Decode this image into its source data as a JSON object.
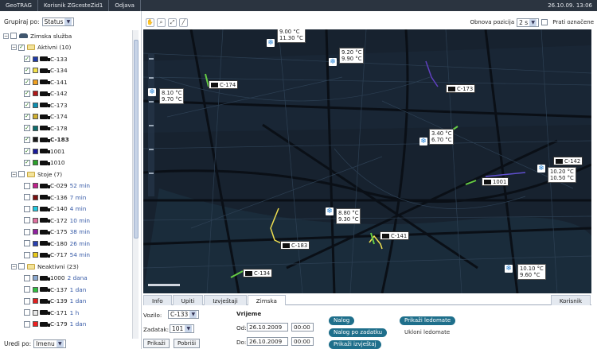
{
  "topbar": {
    "app": "GeoTRAG",
    "user": "Korisnik ZGcesteZid1",
    "logout": "Odjava",
    "datetime": "26.10.09. 13:06"
  },
  "left": {
    "group_label": "Grupiraj po:",
    "group_value": "Status",
    "sort_label": "Uredi po:",
    "sort_value": "Imenu",
    "tree": {
      "root": "Zimska služba",
      "groups": [
        {
          "label": "Aktivni (10)",
          "items": [
            {
              "name": "C-133",
              "color": "#1e3aa8",
              "dur": ""
            },
            {
              "name": "C-134",
              "color": "#f3e14a",
              "dur": ""
            },
            {
              "name": "C-141",
              "color": "#f0a020",
              "dur": ""
            },
            {
              "name": "C-142",
              "color": "#b01818",
              "dur": ""
            },
            {
              "name": "C-173",
              "color": "#0e8fb0",
              "dur": ""
            },
            {
              "name": "C-174",
              "color": "#d0b030",
              "dur": ""
            },
            {
              "name": "C-178",
              "color": "#0c6c6c",
              "dur": ""
            },
            {
              "name": "C-183",
              "color": "#1a1a1a",
              "dur": ""
            },
            {
              "name": "1001",
              "color": "#1a1a9a",
              "dur": ""
            },
            {
              "name": "1010",
              "color": "#2aa02a",
              "dur": ""
            }
          ]
        },
        {
          "label": "Stoje (7)",
          "items": [
            {
              "name": "C-029",
              "color": "#c0208c",
              "dur": "52 min"
            },
            {
              "name": "C-136",
              "color": "#7a1010",
              "dur": "7 min"
            },
            {
              "name": "C-140",
              "color": "#20c8e0",
              "dur": "4 min"
            },
            {
              "name": "C-172",
              "color": "#e070a0",
              "dur": "10 min"
            },
            {
              "name": "C-175",
              "color": "#9020a0",
              "dur": "38 min"
            },
            {
              "name": "C-180",
              "color": "#2a40b0",
              "dur": "26 min"
            },
            {
              "name": "C-717",
              "color": "#e8c818",
              "dur": "54 min"
            }
          ]
        },
        {
          "label": "Neaktivni (23)",
          "items": [
            {
              "name": "1000",
              "color": "#8aa8d0",
              "dur": "2 dana"
            },
            {
              "name": "C-137",
              "color": "#30c040",
              "dur": "1 dan"
            },
            {
              "name": "C-139",
              "color": "#e02020",
              "dur": "1 dan"
            },
            {
              "name": "C-171",
              "color": "#e8e8e8",
              "dur": "1 h"
            },
            {
              "name": "C-179",
              "color": "#ee2020",
              "dur": "1 dan"
            }
          ]
        }
      ]
    }
  },
  "map_toolbar": {
    "refresh_label": "Obnova pozicija",
    "refresh_value": "2 s",
    "follow_label": "Prati označene"
  },
  "map": {
    "vehicles": [
      {
        "name": "C-174"
      },
      {
        "name": "C-173"
      },
      {
        "name": "C-142"
      },
      {
        "name": "1001"
      },
      {
        "name": "C-141"
      },
      {
        "name": "C-183"
      },
      {
        "name": "C-134"
      }
    ],
    "temps": [
      {
        "a": "9.00 °C",
        "b": "11.30 °C"
      },
      {
        "a": "9.20 °C",
        "b": "9.90 °C"
      },
      {
        "a": "8.10 °C",
        "b": "9.70 °C"
      },
      {
        "a": "3.40 °C",
        "b": "6.70 °C"
      },
      {
        "a": "10.20 °C",
        "b": "10.50 °C"
      },
      {
        "a": "8.80 °C",
        "b": "9.30 °C"
      },
      {
        "a": "10.10 °C",
        "b": "9.60 °C"
      }
    ]
  },
  "tabs": {
    "info": "Info",
    "upiti": "Upiti",
    "izvjestaji": "Izvještaji",
    "zimska": "Zimska",
    "korisnik": "Korisnik"
  },
  "form": {
    "vozilo_label": "Vozilo:",
    "vozilo_value": "C-133",
    "zadatak_label": "Zadatak:",
    "zadatak_value": "101",
    "prikazi": "Prikaži",
    "pobrisi": "Pobriši",
    "vrijeme_label": "Vrijeme",
    "od_label": "Od:",
    "od_date": "26.10.2009",
    "od_time": "00:00",
    "do_label": "Do:",
    "do_date": "26.10.2009",
    "do_time": "00:00",
    "nalog": "Nalog",
    "nalog_po_zadatku": "Nalog po zadatku",
    "prikazi_izvjestaj": "Prikaži izvještaj",
    "prikazi_ledomate": "Prikaži ledomate",
    "ukloni_ledomate": "Ukloni ledomate"
  }
}
